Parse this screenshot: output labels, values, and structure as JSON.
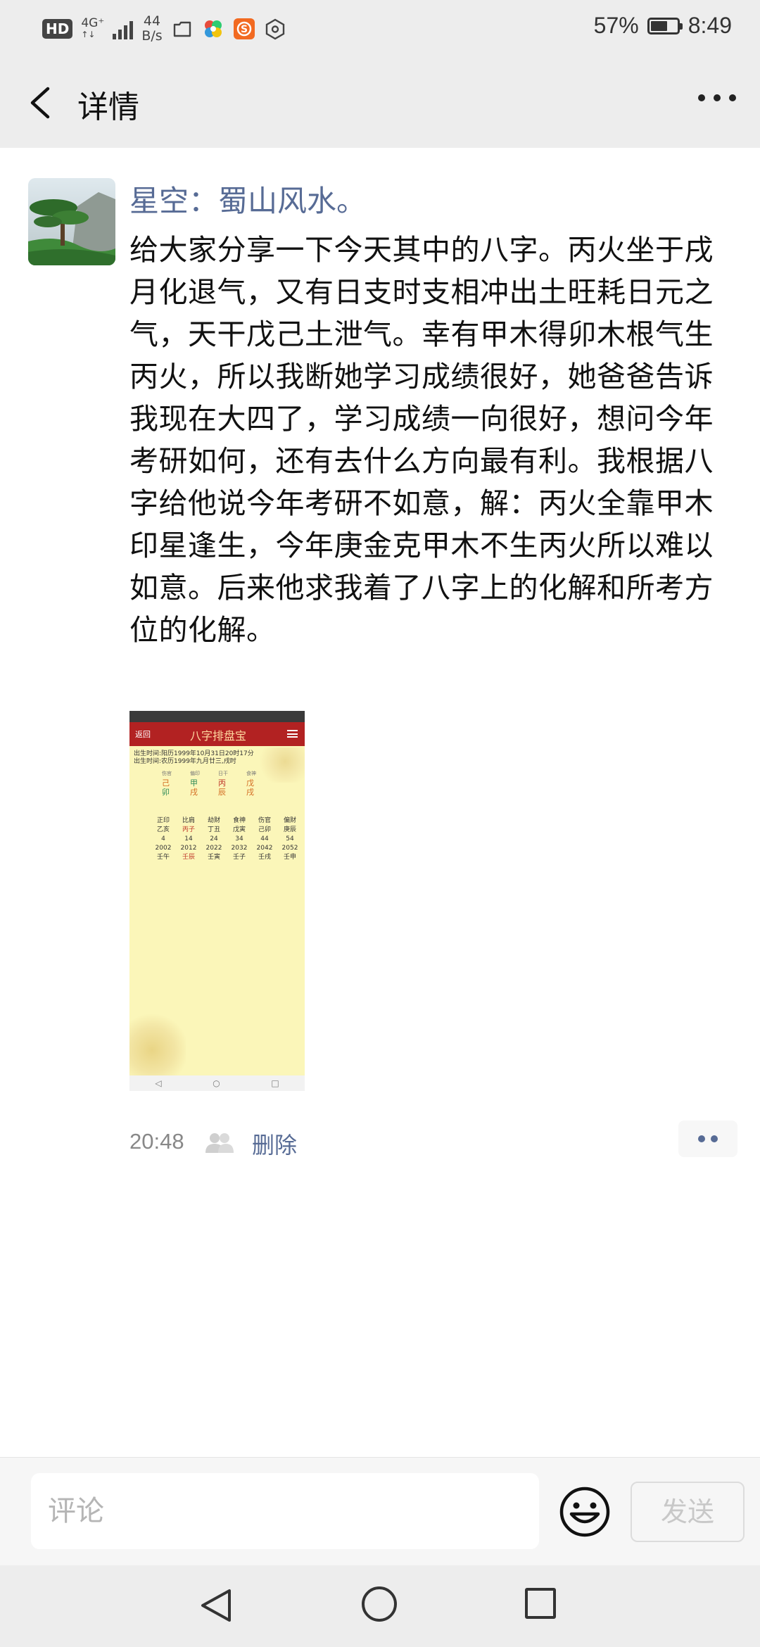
{
  "status_bar": {
    "hd": "HD",
    "network": "4G⁺",
    "network_sub": "↑↓",
    "speed_value": "44",
    "speed_unit": "B/s",
    "battery_percent": "57%",
    "battery_level": 0.57,
    "time": "8:49",
    "app_icons": [
      "folder-icon",
      "colorful-app-icon",
      "s-app-icon",
      "hexagon-app-icon"
    ]
  },
  "nav": {
    "title": "详情",
    "back_icon": "chevron-left-icon",
    "more_icon": "more-dots-icon"
  },
  "post": {
    "username": "星空：蜀山风水。",
    "text": "给大家分享一下今天其中的八字。丙火坐于戌月化退气，又有日支时支相冲出土旺耗日元之气，天干戊己土泄气。幸有甲木得卯木根气生丙火，所以我断她学习成绩很好，她爸爸告诉我现在大四了，学习成绩一向很好，想问今年考研如何，还有去什么方向最有利。我根据八字给他说今年考研不如意，解：丙火全靠甲木印星逢生，今年庚金克甲木不生丙火所以难以如意。后来他求我着了八字上的化解和所考方位的化解。",
    "time": "20:48",
    "delete_label": "删除",
    "image": {
      "header_back": "返回",
      "header_title": "八字排盘宝",
      "birth_solar": "出生时间:阳历1999年10月31日20时17分",
      "birth_lunar": "出生时间:农历1999年九月廿三,戌时",
      "pillar_gods": [
        "伤官",
        "偏印",
        "日干",
        "食神"
      ],
      "stems": [
        "己",
        "甲",
        "丙",
        "戊"
      ],
      "branches": [
        "卯",
        "戌",
        "辰",
        "戌"
      ],
      "dayun_gods": [
        "正印",
        "比肩",
        "劫财",
        "食神",
        "伤官",
        "偏财"
      ],
      "dayun": [
        "乙亥",
        "丙子",
        "丁丑",
        "戊寅",
        "己卯",
        "庚辰"
      ],
      "dayun_ages": [
        "4",
        "14",
        "24",
        "34",
        "44",
        "54"
      ],
      "dayun_years": [
        "2002",
        "2012",
        "2022",
        "2032",
        "2042",
        "2052"
      ],
      "liunian": [
        "壬午",
        "壬辰",
        "壬寅",
        "壬子",
        "壬戌",
        "壬申"
      ]
    }
  },
  "bottom": {
    "comment_placeholder": "评论",
    "send_label": "发送",
    "emoji_icon": "smiley-icon"
  },
  "system_nav": {
    "back": "triangle-back-icon",
    "home": "circle-home-icon",
    "recent": "square-recent-icon"
  }
}
